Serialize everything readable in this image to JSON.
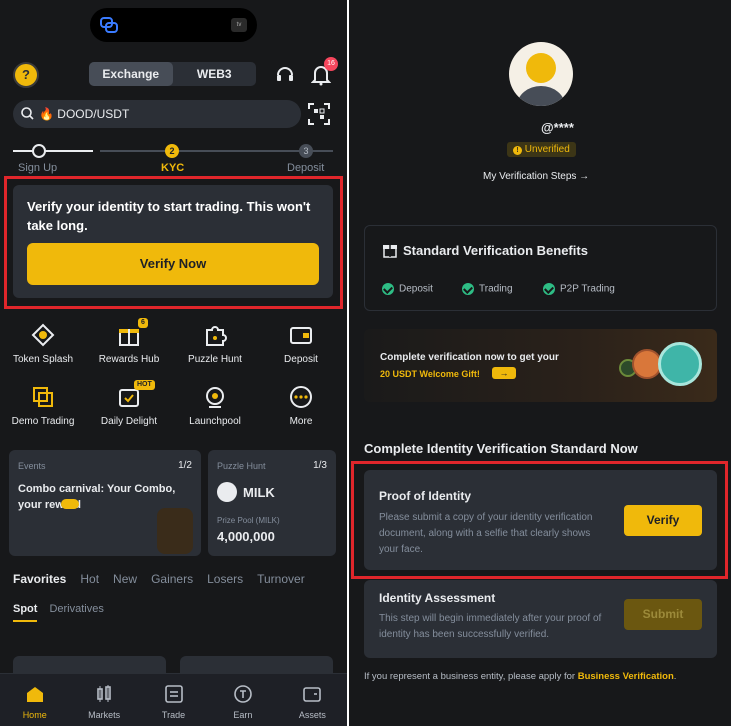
{
  "left": {
    "header": {
      "avatar_glyph": "?",
      "tab_exchange": "Exchange",
      "tab_web3": "WEB3",
      "notification_count": "16"
    },
    "search": {
      "value": "🔥 DOOD/USDT"
    },
    "progress": {
      "step1": "Sign Up",
      "step2_num": "2",
      "step2": "KYC",
      "step3_num": "3",
      "step3": "Deposit"
    },
    "kyc": {
      "message": "Verify your identity to start trading. This won't take long.",
      "button": "Verify Now"
    },
    "grid": [
      {
        "label": "Token Splash",
        "icon": "token-splash-icon"
      },
      {
        "label": "Rewards Hub",
        "icon": "gift-icon",
        "badge": "6"
      },
      {
        "label": "Puzzle Hunt",
        "icon": "puzzle-icon"
      },
      {
        "label": "Deposit",
        "icon": "wallet-icon"
      },
      {
        "label": "Demo Trading",
        "icon": "demo-icon"
      },
      {
        "label": "Daily Delight",
        "icon": "calendar-icon",
        "badge": "HOT"
      },
      {
        "label": "Launchpool",
        "icon": "launchpool-icon"
      },
      {
        "label": "More",
        "icon": "more-icon"
      }
    ],
    "events_card": {
      "tag": "Events",
      "page": "1/2",
      "title": "Combo carnival: Your Combo, your reward"
    },
    "puzzle_card": {
      "tag": "Puzzle Hunt",
      "page": "1/3",
      "token": "MILK",
      "pool_label": "Prize Pool (MILK)",
      "pool_value": "4,000,000"
    },
    "market_tabs": [
      "Favorites",
      "Hot",
      "New",
      "Gainers",
      "Losers",
      "Turnover"
    ],
    "sub_tabs": [
      "Spot",
      "Derivatives"
    ],
    "bottom_nav": [
      "Home",
      "Markets",
      "Trade",
      "Earn",
      "Assets"
    ]
  },
  "right": {
    "username": "@****",
    "status": "Unverified",
    "steps_link": "My Verification Steps →",
    "benefits": {
      "title": "Standard Verification Benefits",
      "items": [
        "Deposit",
        "Trading",
        "P2P Trading"
      ]
    },
    "promo": {
      "line1": "Complete verification now to get your",
      "line2": "20 USDT Welcome Gift!",
      "arrow": "→"
    },
    "section_title": "Complete Identity Verification Standard Now",
    "poi": {
      "title": "Proof of Identity",
      "desc": "Please submit a copy of your identity verification document, along with a selfie that clearly shows your face.",
      "button": "Verify"
    },
    "ia": {
      "title": "Identity Assessment",
      "desc": "This step will begin immediately after your proof of identity has been successfully verified.",
      "button": "Submit"
    },
    "footer": {
      "text": "If you represent a business entity, please apply for ",
      "link": "Business Verification",
      "end": "."
    }
  },
  "colors": {
    "accent": "#f0b90b",
    "bg": "#17181a",
    "card": "#2b2f36",
    "highlight": "#e0262b",
    "success": "#2ebd85"
  }
}
